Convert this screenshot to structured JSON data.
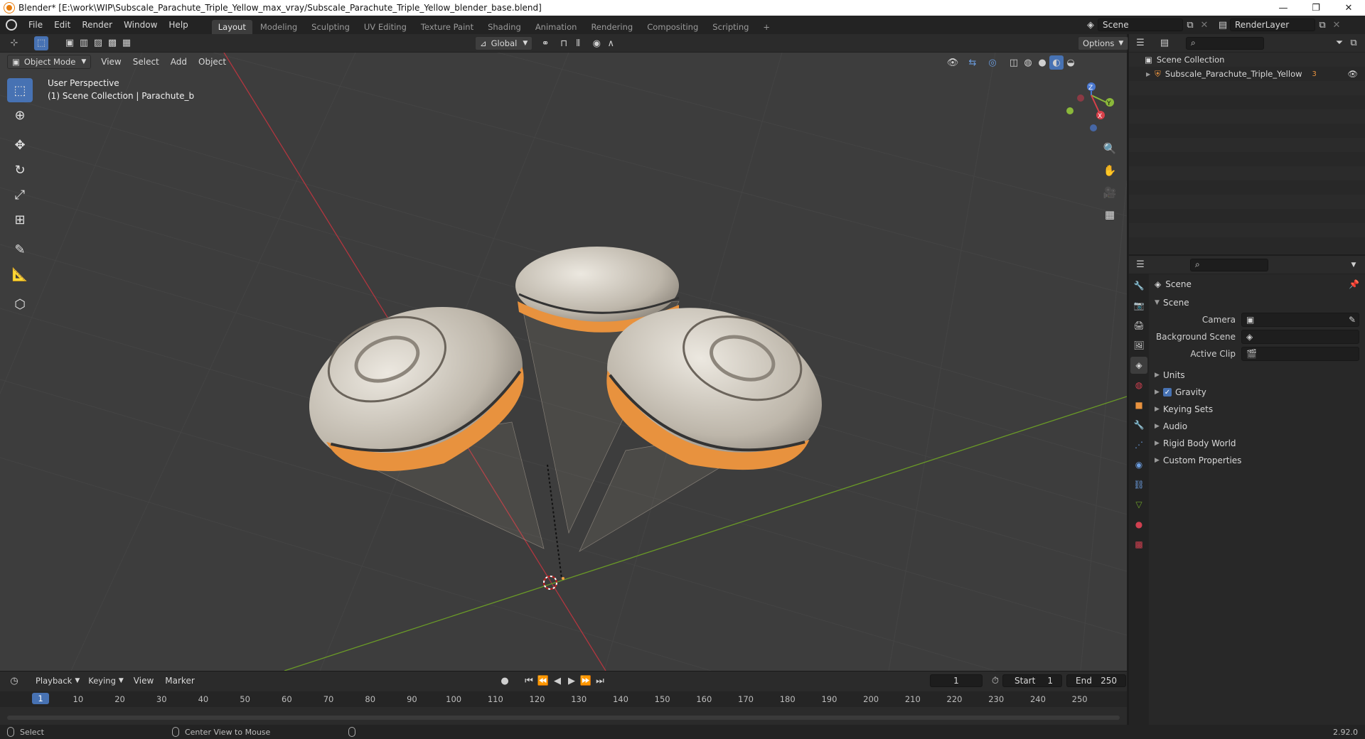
{
  "titlebar": {
    "title": "Blender* [E:\\work\\WIP\\Subscale_Parachute_Triple_Yellow_max_vray/Subscale_Parachute_Triple_Yellow_blender_base.blend]",
    "minimize": "—",
    "maximize": "❐",
    "close": "✕"
  },
  "menu": [
    "File",
    "Edit",
    "Render",
    "Window",
    "Help"
  ],
  "workspaces": [
    "Layout",
    "Modeling",
    "Sculpting",
    "UV Editing",
    "Texture Paint",
    "Shading",
    "Animation",
    "Rendering",
    "Compositing",
    "Scripting"
  ],
  "add_workspace": "+",
  "scene_field": "Scene",
  "renderlayer_field": "RenderLayer",
  "viewport_header": {
    "transform_orientation": "Global",
    "options": "Options"
  },
  "viewport_header2": {
    "mode": "Object Mode",
    "menus": [
      "View",
      "Select",
      "Add",
      "Object"
    ]
  },
  "viewport_overlay": {
    "perspective": "User Perspective",
    "collection": "(1) Scene Collection | Parachute_b"
  },
  "gizmo_axes": {
    "x": "X",
    "y": "Y",
    "z": "Z"
  },
  "outliner": {
    "root": "Scene Collection",
    "object": "Subscale_Parachute_Triple_Yellow",
    "object_badge": "3"
  },
  "properties": {
    "context": "Scene",
    "section": "Scene",
    "fields": [
      {
        "label": "Camera",
        "value": ""
      },
      {
        "label": "Background Scene",
        "value": ""
      },
      {
        "label": "Active Clip",
        "value": ""
      }
    ],
    "panels": [
      "Units",
      "Gravity",
      "Keying Sets",
      "Audio",
      "Rigid Body World",
      "Custom Properties"
    ]
  },
  "timeline": {
    "menus": [
      "Playback",
      "Keying",
      "View",
      "Marker"
    ],
    "current_frame": "1",
    "start_label": "Start",
    "start": "1",
    "end_label": "End",
    "end": "250",
    "ticks": [
      "10",
      "20",
      "30",
      "40",
      "50",
      "60",
      "70",
      "80",
      "90",
      "100",
      "110",
      "120",
      "130",
      "140",
      "150",
      "160",
      "170",
      "180",
      "190",
      "200",
      "210",
      "220",
      "230",
      "240",
      "250"
    ],
    "playhead": "1"
  },
  "statusbar": {
    "left": "Select",
    "middle": "Center View to Mouse",
    "version": "2.92.0"
  },
  "colors": {
    "accent": "#4772b3",
    "parachute_orange": "#e8923e",
    "parachute_white": "#d9d4cc",
    "x_axis": "#c1363f",
    "y_axis": "#6fa22a"
  }
}
